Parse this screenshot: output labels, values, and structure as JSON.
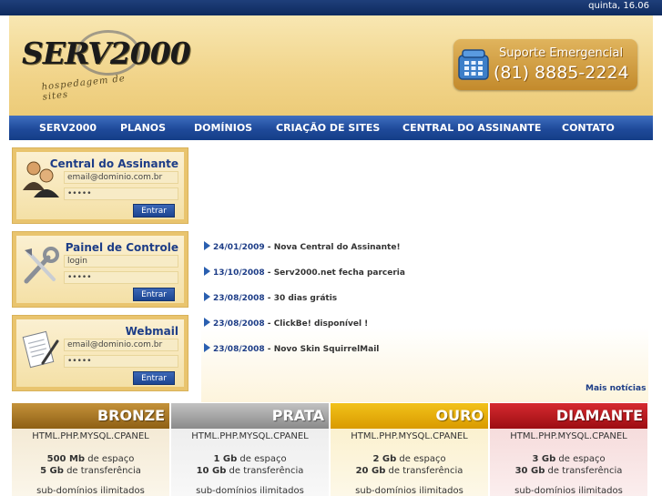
{
  "date": "quinta, 16.06",
  "logo": {
    "main": "SERV2000",
    "sub": "hospedagem de sites"
  },
  "support": {
    "title": "Suporte Emergencial",
    "number": "(81) 8885-2224"
  },
  "nav": [
    "SERV2000",
    "PLANOS",
    "DOMÍNIOS",
    "CRIAÇÃO DE SITES",
    "CENTRAL DO ASSINANTE",
    "CONTATO"
  ],
  "boxes": {
    "central": {
      "title": "Central do Assinante",
      "field1": "email@dominio.com.br",
      "field2": "•••••",
      "button": "Entrar"
    },
    "painel": {
      "title": "Painel de Controle",
      "field1": "login",
      "field2": "•••••",
      "button": "Entrar"
    },
    "webmail": {
      "title": "Webmail",
      "field1": "email@dominio.com.br",
      "field2": "•••••",
      "button": "Entrar"
    }
  },
  "news": [
    {
      "date": "24/01/2009",
      "sep": " - ",
      "text": "Nova Central do Assinante!"
    },
    {
      "date": "13/10/2008",
      "sep": " - ",
      "text": "Serv2000.net fecha parceria"
    },
    {
      "date": "23/08/2008",
      "sep": " - ",
      "text": "30 dias grátis"
    },
    {
      "date": "23/08/2008",
      "sep": " - ",
      "text": "ClickBe! disponível !"
    },
    {
      "date": "23/08/2008",
      "sep": " - ",
      "text": "Novo Skin SquirrelMail"
    }
  ],
  "more_news": "Mais notícias",
  "plans": [
    {
      "name": "BRONZE",
      "tech": "HTML.PHP.MYSQL.CPANEL",
      "space_val": "500 Mb",
      "space_txt": " de espaço",
      "transfer_val": "5 Gb",
      "transfer_txt": " de transferência",
      "sub": "sub-domínios ilimitados",
      "color": "#a9761f"
    },
    {
      "name": "PRATA",
      "tech": "HTML.PHP.MYSQL.CPANEL",
      "space_val": "1 Gb",
      "space_txt": " de espaço",
      "transfer_val": "10 Gb",
      "transfer_txt": " de transferência",
      "sub": "sub-domínios ilimitados",
      "color": "#9a9a9a"
    },
    {
      "name": "OURO",
      "tech": "HTML.PHP.MYSQL.CPANEL",
      "space_val": "2 Gb",
      "space_txt": " de espaço",
      "transfer_val": "20 Gb",
      "transfer_txt": " de transferência",
      "sub": "sub-domínios ilimitados",
      "color": "#e0a800"
    },
    {
      "name": "DIAMANTE",
      "tech": "HTML.PHP.MYSQL.CPANEL",
      "space_val": "3 Gb",
      "space_txt": " de espaço",
      "transfer_val": "30 Gb",
      "transfer_txt": " de transferência",
      "sub": "sub-domínios ilimitados",
      "color": "#b8151b"
    }
  ]
}
